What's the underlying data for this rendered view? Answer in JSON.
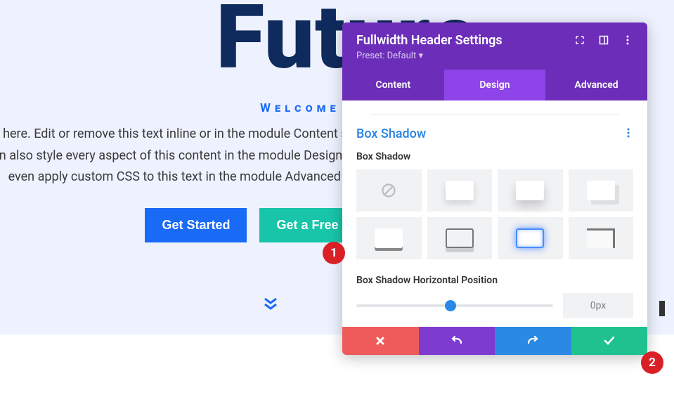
{
  "hero": {
    "title": "Future",
    "subtitle": "Welcome to Divi",
    "body": "es here. Edit or remove this text inline or in the module Content settings. You can also style every aspect of this content in the module Design settings and even apply custom CSS to this text in the module Advanced settings.",
    "get_started": "Get Started",
    "get_quote": "Get a Free Quote"
  },
  "panel": {
    "title": "Fullwidth Header Settings",
    "preset": "Preset: Default",
    "tabs": {
      "content": "Content",
      "design": "Design",
      "advanced": "Advanced"
    },
    "section_title": "Box Shadow",
    "option_label": "Box Shadow",
    "slider_label": "Box Shadow Horizontal Position",
    "slider_value": "0px"
  },
  "callouts": {
    "one": "1",
    "two": "2"
  }
}
